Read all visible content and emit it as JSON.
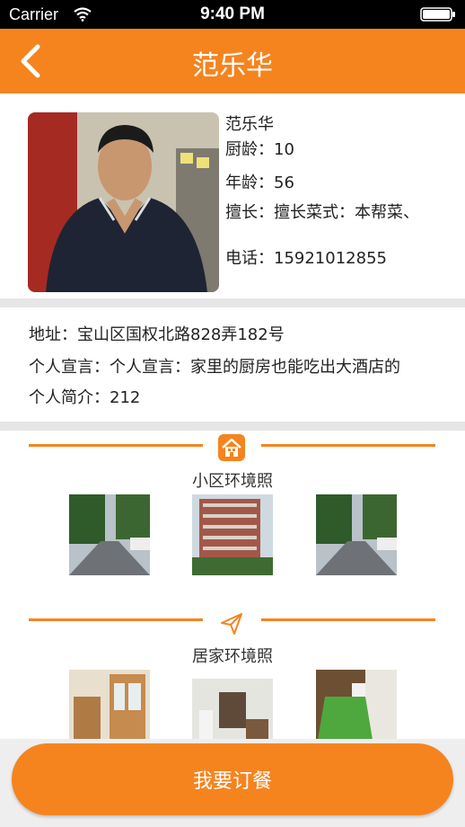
{
  "status_bar": {
    "carrier": "Carrier",
    "time": "9:40 PM"
  },
  "nav": {
    "title": "范乐华"
  },
  "profile": {
    "name": "范乐华",
    "chef_age_label": "厨龄：",
    "chef_age": "10",
    "age_label": "年龄：",
    "age": "56",
    "specialty_label": "擅长：",
    "specialty": "擅长菜式：本帮菜、",
    "phone_label": "电话：",
    "phone": "15921012855"
  },
  "details": {
    "address_label": "地址：",
    "address": "宝山区国权北路828弄182号",
    "declaration_label": "个人宣言：",
    "declaration": "个人宣言：家里的厨房也能吃出大酒店的",
    "intro_label": "个人简介：",
    "intro": "212"
  },
  "sections": {
    "community": {
      "title": "小区环境照",
      "icon": "house-icon"
    },
    "home": {
      "title": "居家环境照",
      "icon": "paper-plane-icon"
    }
  },
  "order_button": {
    "label": "我要订餐"
  },
  "colors": {
    "accent": "#f5841f"
  }
}
